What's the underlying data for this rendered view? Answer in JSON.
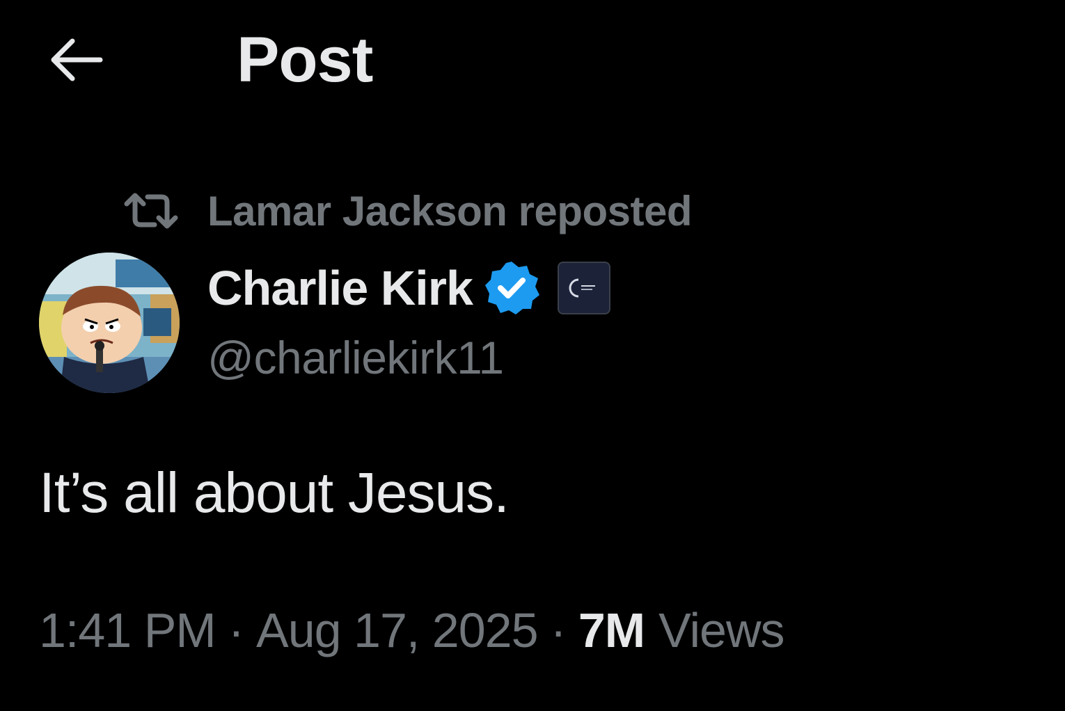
{
  "header": {
    "title": "Post",
    "back_icon": "arrow-left-icon"
  },
  "repost": {
    "icon": "repost-icon",
    "text": "Lamar Jackson reposted"
  },
  "author": {
    "display_name": "Charlie Kirk",
    "handle": "@charliekirk11",
    "verified_badge_icon": "verified-badge-icon",
    "verified_color": "#1d9bf0",
    "affiliate_badge_icon": "affiliate-badge-icon"
  },
  "post": {
    "text": "It’s all about Jesus."
  },
  "meta": {
    "time": "1:41 PM",
    "separator": "·",
    "date": "Aug 17, 2025",
    "views_count": "7M",
    "views_label": "Views"
  },
  "colors": {
    "background": "#000000",
    "primary_text": "#e7e9ea",
    "secondary_text": "#71767b"
  }
}
